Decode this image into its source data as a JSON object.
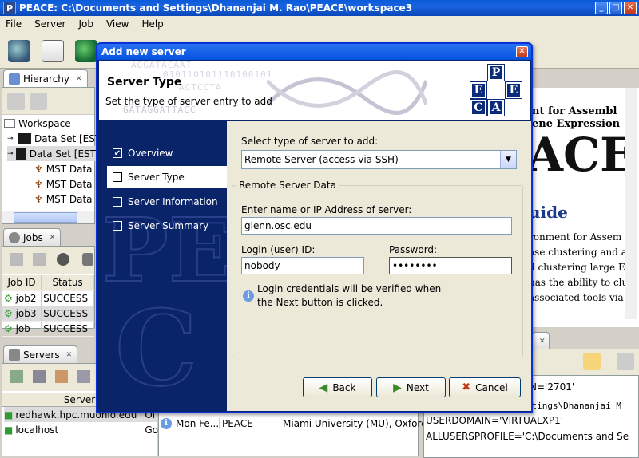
{
  "app": {
    "title": "PEACE: C:\\Documents and Settings\\Dhananjai M. Rao\\PEACE\\workspace3",
    "icon_letter": "P"
  },
  "menu": [
    "File",
    "Server",
    "Job",
    "View",
    "Help"
  ],
  "hierarchy": {
    "tab": "Hierarchy",
    "items": [
      {
        "label": "Workspace"
      },
      {
        "label": "Data Set [EST"
      },
      {
        "label": "Data Set [EST"
      },
      {
        "label": "MST Data"
      },
      {
        "label": "MST Data"
      },
      {
        "label": "MST Data"
      }
    ]
  },
  "jobs": {
    "tab": "Jobs",
    "columns": [
      "Job ID",
      "Status"
    ],
    "rows": [
      {
        "id": "job2",
        "status": "SUCCESS"
      },
      {
        "id": "job3",
        "status": "SUCCESS"
      },
      {
        "id": "job",
        "status": "SUCCESS"
      }
    ]
  },
  "servers": {
    "tab": "Servers",
    "column": "Server",
    "rows": [
      {
        "name": "redhawk.hpc.muohio.edu",
        "extra": "Ol"
      },
      {
        "name": "localhost",
        "extra": "Go"
      }
    ]
  },
  "log": {
    "rows": [
      {
        "date": "Mon Fe...",
        "source": "PEACE",
        "msg": "Miami University (MU), Oxford, O"
      }
    ]
  },
  "doc_view": {
    "line1": "nt for Assembl",
    "line2": "ene Expression",
    "big": "ACE",
    "heading": "uide",
    "para": [
      "ronment for Assem",
      "ase clustering and a",
      "d clustering large E",
      "has the ability to clu",
      "associated tools via"
    ]
  },
  "env_view": {
    "lines": [
      "N='2701'",
      "C:\\Documents and Settings\\Dhananjai M",
      "USERDOMAIN='VIRTUALXP1'",
      "ALLUSERSPROFILE='C:\\Documents and Se"
    ]
  },
  "dialog": {
    "title": "Add new server",
    "header_title": "Server Type",
    "header_subtitle": "Set the type of server entry to add",
    "logo_letters": [
      "P",
      "E",
      "E",
      "C",
      "A"
    ],
    "dna_text": [
      "AGGATACAAT  ",
      "010110101110100101",
      "ACTCCTA",
      "GATAGGATTACC"
    ],
    "steps": [
      {
        "label": "Overview",
        "checked": "✔"
      },
      {
        "label": "Server Type",
        "checked": ""
      },
      {
        "label": "Server Information",
        "checked": ""
      },
      {
        "label": "Server Summary",
        "checked": ""
      }
    ],
    "select_label": "Select type of server to add:",
    "select_value": "Remote Server (access via SSH)",
    "group_label": "Remote Server Data",
    "host_label": "Enter name or IP Address of server:",
    "host_value": "glenn.osc.edu",
    "login_label": "Login (user) ID:",
    "login_value": "nobody",
    "password_label": "Password:",
    "password_value": "••••••••",
    "note_line1": "Login credentials will be verified when",
    "note_line2": "the Next button is clicked.",
    "back": "Back",
    "next": "Next",
    "cancel": "Cancel"
  }
}
